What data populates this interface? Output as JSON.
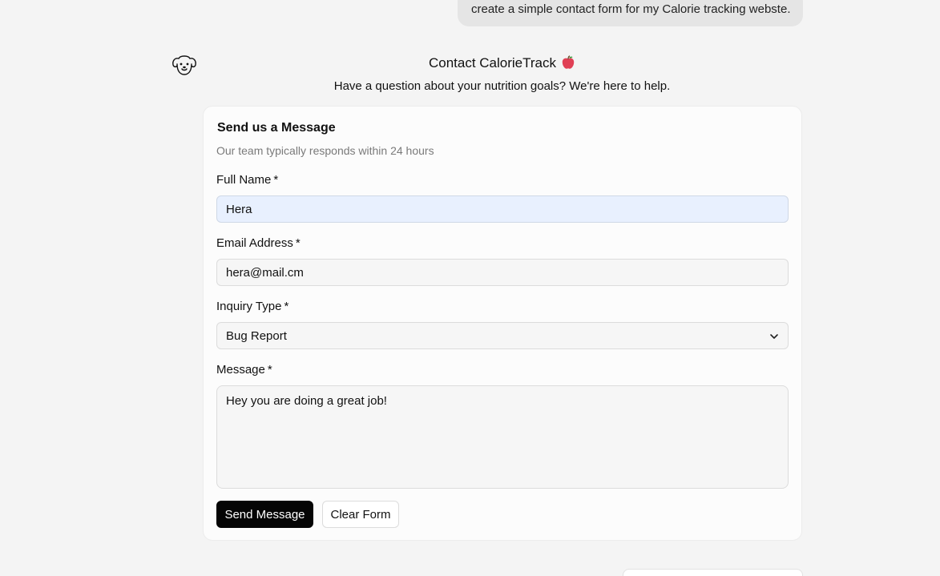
{
  "chat": {
    "user_message": "create a simple contact form for my Calorie tracking webste."
  },
  "header": {
    "title": "Contact CalorieTrack",
    "subtitle": "Have a question about your nutrition goals? We're here to help."
  },
  "card": {
    "title": "Send us a Message",
    "description": "Our team typically responds within 24 hours"
  },
  "form": {
    "required_marker": "*",
    "full_name": {
      "label": "Full Name",
      "value": "Hera"
    },
    "email": {
      "label": "Email Address",
      "value": "hera@mail.cm"
    },
    "inquiry_type": {
      "label": "Inquiry Type",
      "value": "Bug Report"
    },
    "message": {
      "label": "Message",
      "value": "Hey you are doing a great job!"
    },
    "send_label": "Send Message",
    "clear_label": "Clear Form"
  },
  "icons": {
    "avatar": "dog-face-icon",
    "title_emoji": "apple-icon",
    "select_arrow": "chevron-down-icon"
  },
  "colors": {
    "page_background": "#f4f4f4",
    "primary_button": "#050505",
    "autofill_background": "#e8f0fe",
    "apple_red": "#e04055"
  }
}
